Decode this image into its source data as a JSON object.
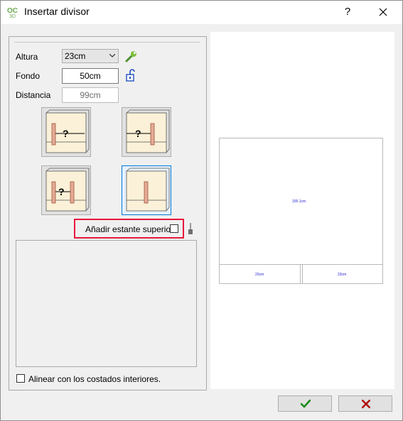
{
  "window": {
    "title": "Insertar divisor",
    "help_label": "?"
  },
  "form": {
    "altura_label": "Altura",
    "altura_value": "23cm",
    "fondo_label": "Fondo",
    "fondo_value": "50cm",
    "distancia_label": "Distancia",
    "distancia_value": "99cm"
  },
  "options": {
    "selected_index": 3,
    "add_top_shelf_label": "Añadir estante superior",
    "add_top_shelf_checked": false
  },
  "align_label": "Alinear con los costados interiores.",
  "align_checked": false,
  "preview": {
    "main_dim": "155.1cm",
    "left_dim": "23cm",
    "right_dim": "23cm"
  },
  "colors": {
    "ok_icon": "#1e8c1e",
    "cancel_icon": "#b01010",
    "highlight_border": "#e8163b",
    "preview_dim_text": "#2020d0"
  }
}
